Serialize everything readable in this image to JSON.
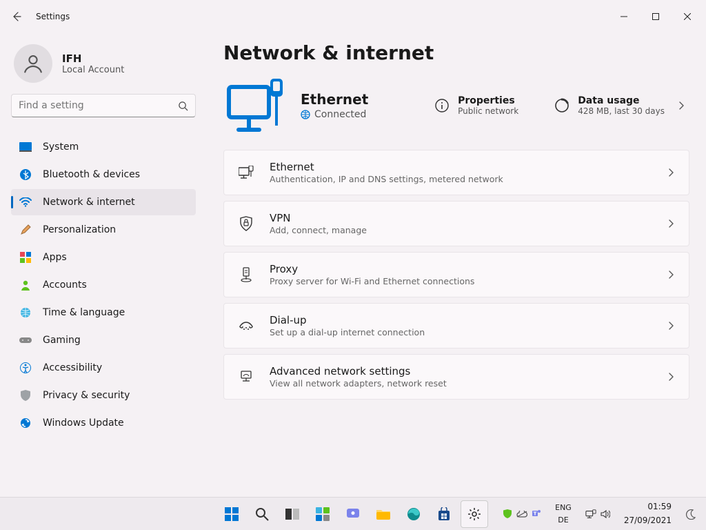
{
  "window": {
    "title": "Settings"
  },
  "user": {
    "name": "IFH",
    "type": "Local Account"
  },
  "search": {
    "placeholder": "Find a setting"
  },
  "nav": {
    "items": [
      {
        "label": "System"
      },
      {
        "label": "Bluetooth & devices"
      },
      {
        "label": "Network & internet"
      },
      {
        "label": "Personalization"
      },
      {
        "label": "Apps"
      },
      {
        "label": "Accounts"
      },
      {
        "label": "Time & language"
      },
      {
        "label": "Gaming"
      },
      {
        "label": "Accessibility"
      },
      {
        "label": "Privacy & security"
      },
      {
        "label": "Windows Update"
      }
    ]
  },
  "page": {
    "title": "Network & internet"
  },
  "hero": {
    "connection_name": "Ethernet",
    "status": "Connected",
    "properties": {
      "title": "Properties",
      "sub": "Public network"
    },
    "usage": {
      "title": "Data usage",
      "sub": "428 MB, last 30 days"
    }
  },
  "cards": [
    {
      "title": "Ethernet",
      "sub": "Authentication, IP and DNS settings, metered network"
    },
    {
      "title": "VPN",
      "sub": "Add, connect, manage"
    },
    {
      "title": "Proxy",
      "sub": "Proxy server for Wi-Fi and Ethernet connections"
    },
    {
      "title": "Dial-up",
      "sub": "Set up a dial-up internet connection"
    },
    {
      "title": "Advanced network settings",
      "sub": "View all network adapters, network reset"
    }
  ],
  "taskbar": {
    "language": {
      "line1": "ENG",
      "line2": "DE"
    },
    "clock": {
      "time": "01:59",
      "date": "27/09/2021"
    }
  }
}
